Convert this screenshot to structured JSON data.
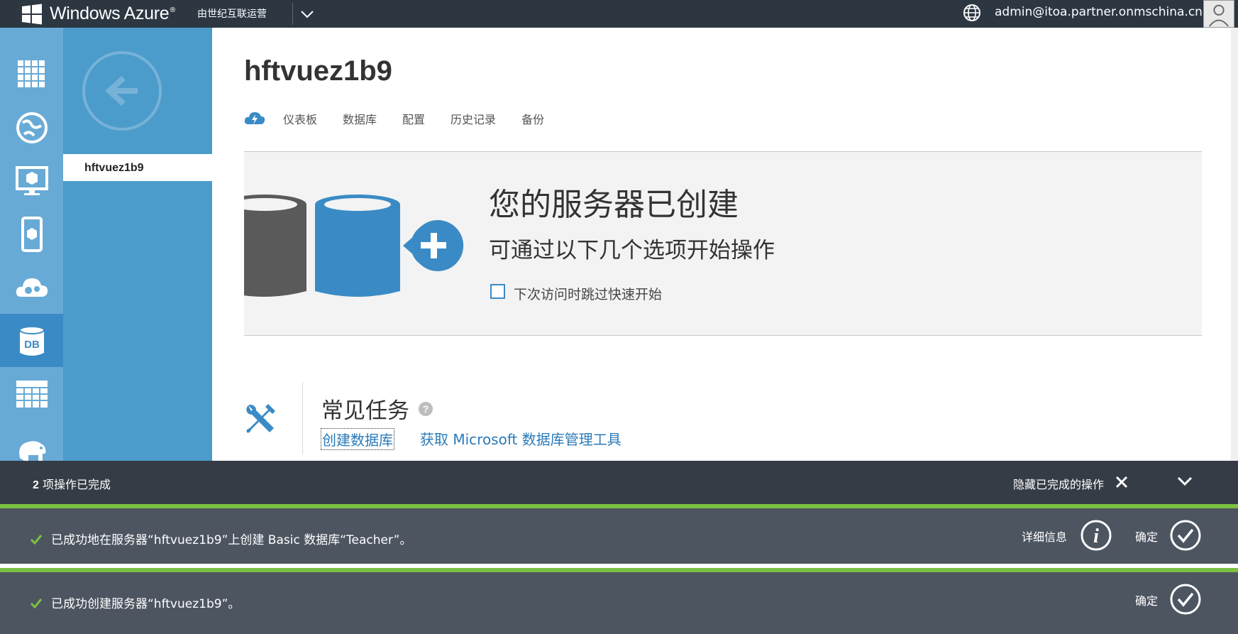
{
  "topbar": {
    "brand": "Windows Azure",
    "operator": "由世纪互联运营",
    "account": "admin@itoa.partner.onmschina.cn"
  },
  "rail": {
    "items": [
      {
        "icon": "all-items-grid-icon"
      },
      {
        "icon": "web-sites-icon"
      },
      {
        "icon": "virtual-machines-icon"
      },
      {
        "icon": "mobile-services-icon"
      },
      {
        "icon": "cloud-services-icon"
      },
      {
        "icon": "sql-databases-icon",
        "label": "DB",
        "active": true
      },
      {
        "icon": "storage-table-icon"
      },
      {
        "icon": "hdinsight-elephant-icon"
      }
    ]
  },
  "panel2": {
    "server_name": "hftvuez1b9"
  },
  "main": {
    "title": "hftvuez1b9",
    "tabs": [
      "仪表板",
      "数据库",
      "配置",
      "历史记录",
      "备份"
    ]
  },
  "quickstart": {
    "heading": "您的服务器已创建",
    "subheading": "可通过以下几个选项开始操作",
    "skip_label": "下次访问时跳过快速开始"
  },
  "tasks": {
    "title": "常见任务",
    "links": [
      "创建数据库",
      "获取 Microsoft 数据库管理工具"
    ]
  },
  "notifications": {
    "count": "2",
    "summary": "项操作已完成",
    "hide_label": "隐藏已完成的操作",
    "items": [
      {
        "message": "已成功地在服务器“hftvuez1b9”上创建 Basic 数据库“Teacher”。",
        "detail_label": "详细信息",
        "confirm_label": "确定"
      },
      {
        "message": "已成功创建服务器“hftvuez1b9”。",
        "confirm_label": "确定"
      }
    ]
  },
  "colors": {
    "topbar": "#2c3742",
    "rail": "#68aad6",
    "panel2": "#4c9ccb",
    "accent": "#3a8bc5",
    "success": "#7bc142",
    "notif_bg": "#4d5561"
  }
}
